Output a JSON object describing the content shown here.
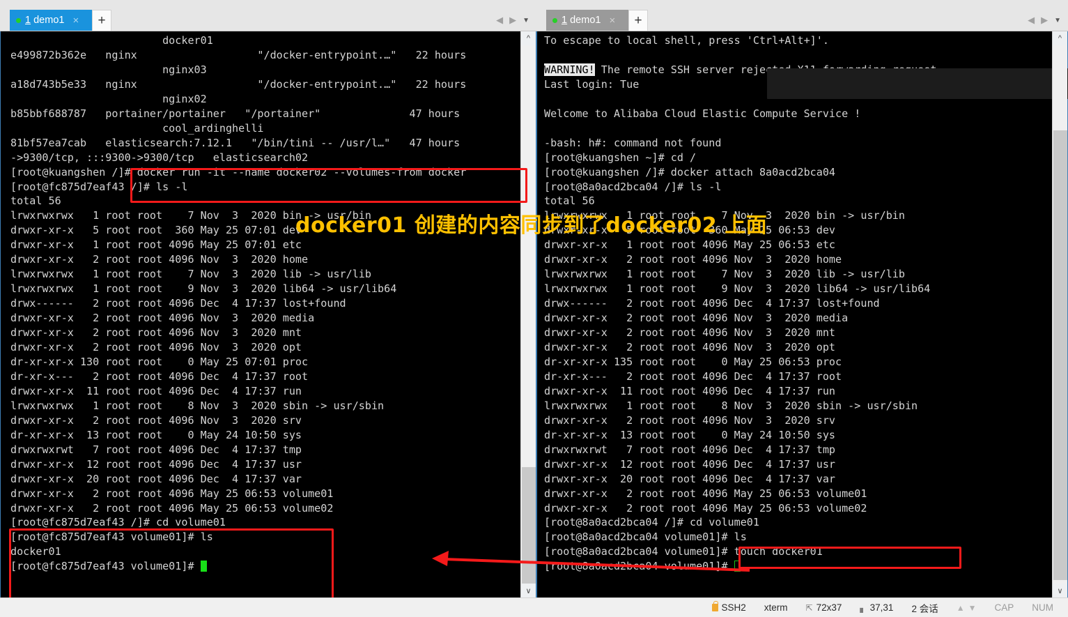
{
  "window": {
    "session_count_label": "2 会话"
  },
  "panes": [
    {
      "id": "left",
      "active": true,
      "tab": {
        "number": "1",
        "name": "demo1",
        "close_label": "×",
        "status_dot_color": "#27d027"
      },
      "newtab_label": "+",
      "nav": {
        "prev": "◀",
        "next": "▶",
        "menu": "▼"
      },
      "terminal_lines": [
        "                        docker01",
        "e499872b362e   nginx                   \"/docker-entrypoint.…\"   22 hours",
        "                        nginx03",
        "a18d743b5e33   nginx                   \"/docker-entrypoint.…\"   22 hours",
        "                        nginx02",
        "b85bbf688787   portainer/portainer   \"/portainer\"              47 hours",
        "                        cool_ardinghelli",
        "81bf57ea7cab   elasticsearch:7.12.1   \"/bin/tini -- /usr/l…\"   47 hours",
        "->9300/tcp, :::9300->9300/tcp   elasticsearch02",
        "[root@kuangshen /]# docker run -it --name docker02 --volumes-from docker",
        "[root@fc875d7eaf43 /]# ls -l",
        "total 56",
        "lrwxrwxrwx   1 root root    7 Nov  3  2020 bin -> usr/bin",
        "drwxr-xr-x   5 root root  360 May 25 07:01 dev",
        "drwxr-xr-x   1 root root 4096 May 25 07:01 etc",
        "drwxr-xr-x   2 root root 4096 Nov  3  2020 home",
        "lrwxrwxrwx   1 root root    7 Nov  3  2020 lib -> usr/lib",
        "lrwxrwxrwx   1 root root    9 Nov  3  2020 lib64 -> usr/lib64",
        "drwx------   2 root root 4096 Dec  4 17:37 lost+found",
        "drwxr-xr-x   2 root root 4096 Nov  3  2020 media",
        "drwxr-xr-x   2 root root 4096 Nov  3  2020 mnt",
        "drwxr-xr-x   2 root root 4096 Nov  3  2020 opt",
        "dr-xr-xr-x 130 root root    0 May 25 07:01 proc",
        "dr-xr-x---   2 root root 4096 Dec  4 17:37 root",
        "drwxr-xr-x  11 root root 4096 Dec  4 17:37 run",
        "lrwxrwxrwx   1 root root    8 Nov  3  2020 sbin -> usr/sbin",
        "drwxr-xr-x   2 root root 4096 Nov  3  2020 srv",
        "dr-xr-xr-x  13 root root    0 May 24 10:50 sys",
        "drwxrwxrwt   7 root root 4096 Dec  4 17:37 tmp",
        "drwxr-xr-x  12 root root 4096 Dec  4 17:37 usr",
        "drwxr-xr-x  20 root root 4096 Dec  4 17:37 var",
        "drwxr-xr-x   2 root root 4096 May 25 06:53 volume01",
        "drwxr-xr-x   2 root root 4096 May 25 06:53 volume02",
        "[root@fc875d7eaf43 /]# cd volume01",
        "[root@fc875d7eaf43 volume01]# ls",
        "docker01",
        "[root@fc875d7eaf43 volume01]# "
      ],
      "cursor_style": "block"
    },
    {
      "id": "right",
      "active": false,
      "tab": {
        "number": "1",
        "name": "demo1",
        "close_label": "×",
        "status_dot_color": "#27d027"
      },
      "newtab_label": "+",
      "nav": {
        "prev": "◀",
        "next": "▶",
        "menu": "▼"
      },
      "terminal_lines": [
        "To escape to local shell, press 'Ctrl+Alt+]'.",
        "",
        "@@WARNING!@@ The remote SSH server rejected X11 forwarding request.",
        "Last login: Tue",
        "",
        "Welcome to Alibaba Cloud Elastic Compute Service !",
        "",
        "-bash: h#: command not found",
        "[root@kuangshen ~]# cd /",
        "[root@kuangshen /]# docker attach 8a0acd2bca04",
        "[root@8a0acd2bca04 /]# ls -l",
        "total 56",
        "lrwxrwxrwx   1 root root    7 Nov  3  2020 bin -> usr/bin",
        "drwxr-xr-x   5 root root  360 May 25 06:53 dev",
        "drwxr-xr-x   1 root root 4096 May 25 06:53 etc",
        "drwxr-xr-x   2 root root 4096 Nov  3  2020 home",
        "lrwxrwxrwx   1 root root    7 Nov  3  2020 lib -> usr/lib",
        "lrwxrwxrwx   1 root root    9 Nov  3  2020 lib64 -> usr/lib64",
        "drwx------   2 root root 4096 Dec  4 17:37 lost+found",
        "drwxr-xr-x   2 root root 4096 Nov  3  2020 media",
        "drwxr-xr-x   2 root root 4096 Nov  3  2020 mnt",
        "drwxr-xr-x   2 root root 4096 Nov  3  2020 opt",
        "dr-xr-xr-x 135 root root    0 May 25 06:53 proc",
        "dr-xr-x---   2 root root 4096 Dec  4 17:37 root",
        "drwxr-xr-x  11 root root 4096 Dec  4 17:37 run",
        "lrwxrwxrwx   1 root root    8 Nov  3  2020 sbin -> usr/sbin",
        "drwxr-xr-x   2 root root 4096 Nov  3  2020 srv",
        "dr-xr-xr-x  13 root root    0 May 24 10:50 sys",
        "drwxrwxrwt   7 root root 4096 Dec  4 17:37 tmp",
        "drwxr-xr-x  12 root root 4096 Dec  4 17:37 usr",
        "drwxr-xr-x  20 root root 4096 Dec  4 17:37 var",
        "drwxr-xr-x   2 root root 4096 May 25 06:53 volume01",
        "drwxr-xr-x   2 root root 4096 May 25 06:53 volume02",
        "[root@8a0acd2bca04 /]# cd volume01",
        "[root@8a0acd2bca04 volume01]# ls",
        "[root@8a0acd2bca04 volume01]# touch docker01",
        "[root@8a0acd2bca04 volume01]# "
      ],
      "cursor_style": "hollow"
    }
  ],
  "annotations": {
    "chinese_note": "docker01 创建的内容同步到了docker02 上面",
    "chinese_note_color": "#ffc000",
    "box_color": "#f41a1a",
    "arrow_color": "#f41a1a",
    "boxes": [
      {
        "name": "docker-run-command-box"
      },
      {
        "name": "left-volume01-ls-box"
      },
      {
        "name": "right-touch-command-box"
      }
    ]
  },
  "statusbar": {
    "protocol": "SSH2",
    "terminal_type": "xterm",
    "size": "72x37",
    "cursor_pos": "37,31",
    "sessions": "2 会话",
    "caps": "CAP",
    "num": "NUM"
  }
}
